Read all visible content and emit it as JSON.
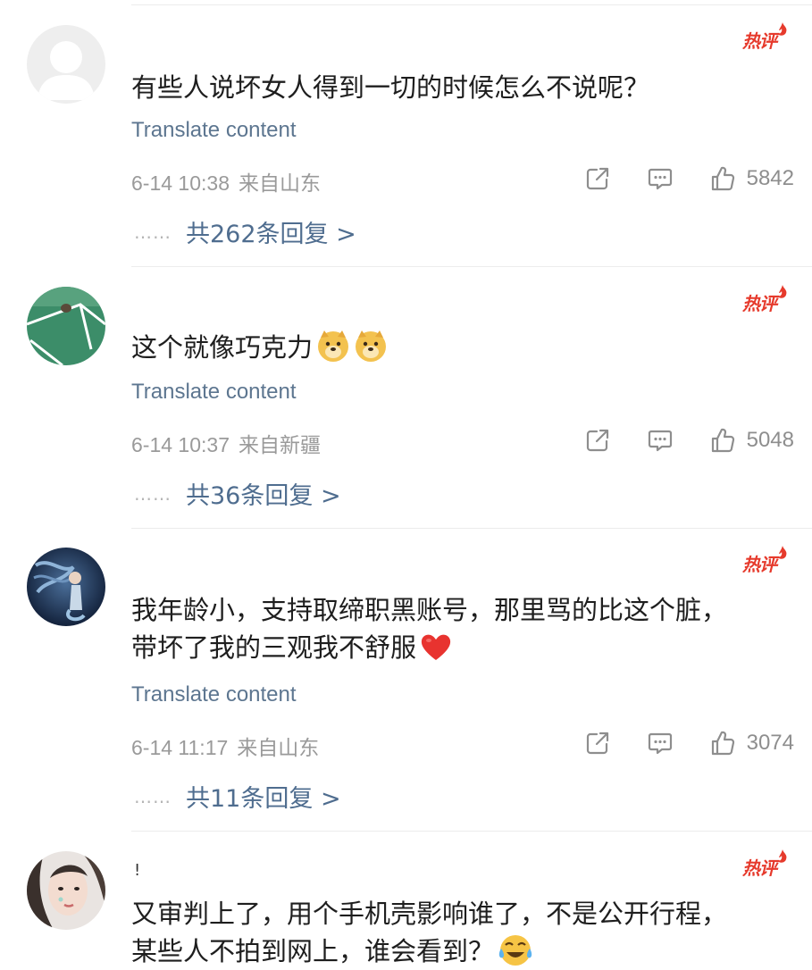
{
  "colors": {
    "hot_badge": "#e63a2c",
    "translate_link": "#5d7690",
    "replies_link": "#4f6d8f",
    "meta_text": "#9a9a9a"
  },
  "comments": [
    {
      "hot_badge": "热评",
      "text_lines": [
        "有些人说坏女人得到一切的时候怎么不说呢？"
      ],
      "translate": "Translate content",
      "date": "6-14 10:38",
      "location": "来自山东",
      "likes": "5842",
      "replies_prefix": "共",
      "replies_count": "262",
      "replies_suffix": "条回复 >",
      "avatar": "default-avatar-icon"
    },
    {
      "hot_badge": "热评",
      "text_lines": [
        "这个就像巧克力"
      ],
      "emoji": [
        "doge-emoji",
        "doge-emoji"
      ],
      "translate": "Translate content",
      "date": "6-14 10:37",
      "location": "来自新疆",
      "likes": "5048",
      "replies_prefix": "共",
      "replies_count": "36",
      "replies_suffix": "条回复 >",
      "avatar": "field-photo-avatar"
    },
    {
      "hot_badge": "热评",
      "text_lines": [
        "我年龄小，支持取缔职黑账号，那里骂的比这个脏，",
        "带坏了我的三观我不舒服"
      ],
      "emoji": [
        "red-heart-emoji"
      ],
      "translate": "Translate content",
      "date": "6-14 11:17",
      "location": "来自山东",
      "likes": "3074",
      "replies_prefix": "共",
      "replies_count": "11",
      "replies_suffix": "条回复 >",
      "avatar": "mermaid-art-avatar"
    },
    {
      "hot_badge": "热评",
      "username": "!",
      "text_lines": [
        "又审判上了，用个手机壳影响谁了，不是公开行程，",
        "某些人不拍到网上，谁会看到？"
      ],
      "emoji": [
        "crying-laughing-emoji"
      ],
      "avatar": "portrait-photo-avatar"
    }
  ]
}
